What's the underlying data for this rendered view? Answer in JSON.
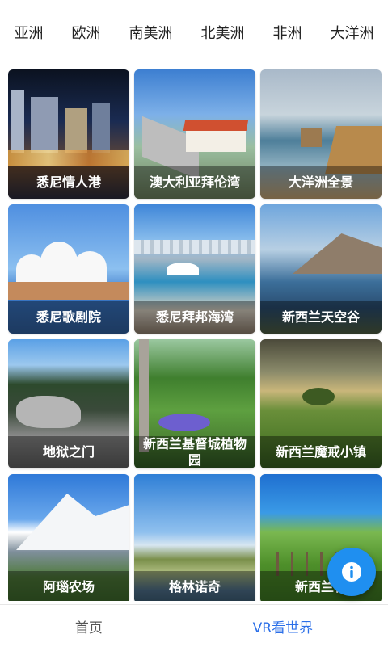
{
  "continent_tabs": [
    "亚洲",
    "欧洲",
    "南美洲",
    "北美洲",
    "非洲",
    "大洋洲"
  ],
  "destinations": [
    {
      "name": "悉尼情人港",
      "scene": "harbor"
    },
    {
      "name": "澳大利亚拜伦湾",
      "scene": "bridge"
    },
    {
      "name": "大洋洲全景",
      "scene": "ocean"
    },
    {
      "name": "悉尼歌剧院",
      "scene": "opera"
    },
    {
      "name": "悉尼拜邦海湾",
      "scene": "bay"
    },
    {
      "name": "新西兰天空谷",
      "scene": "sky"
    },
    {
      "name": "地狱之门",
      "scene": "hell"
    },
    {
      "name": "新西兰基督城植物园",
      "scene": "garden"
    },
    {
      "name": "新西兰魔戒小镇",
      "scene": "hobbit"
    },
    {
      "name": "阿瑙农场",
      "scene": "mount"
    },
    {
      "name": "格林诺奇",
      "scene": "lake"
    },
    {
      "name": "新西兰牧",
      "scene": "field"
    }
  ],
  "bottom_nav": {
    "home": "首页",
    "vr": "VR看世界"
  },
  "fab": {
    "icon": "info-icon",
    "color": "#1f8ff0"
  },
  "colors": {
    "accent": "#2b6fe8"
  }
}
